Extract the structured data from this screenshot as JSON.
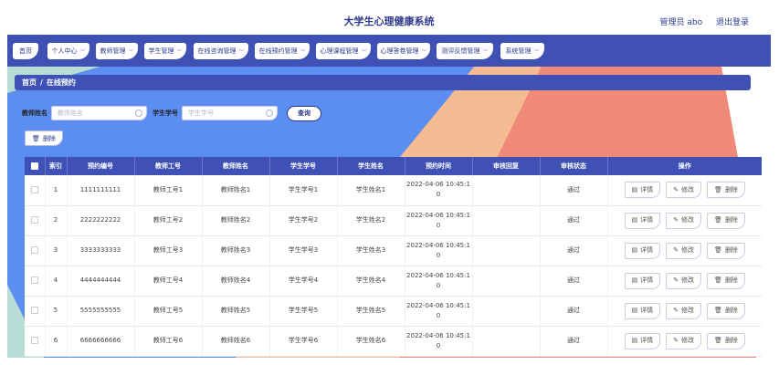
{
  "header": {
    "title": "大学生心理健康系统",
    "admin_label": "管理员 abo",
    "logout_label": "退出登录"
  },
  "nav": {
    "items": [
      {
        "label": "首页",
        "dropdown": false
      },
      {
        "label": "个人中心",
        "dropdown": true
      },
      {
        "label": "教师管理",
        "dropdown": true
      },
      {
        "label": "学生管理",
        "dropdown": true
      },
      {
        "label": "在线咨询管理",
        "dropdown": true
      },
      {
        "label": "在线预约管理",
        "dropdown": true
      },
      {
        "label": "心理课程管理",
        "dropdown": true
      },
      {
        "label": "心理答卷管理",
        "dropdown": true
      },
      {
        "label": "测评反馈管理",
        "dropdown": true
      },
      {
        "label": "系统管理",
        "dropdown": true
      }
    ]
  },
  "breadcrumb": {
    "home": "首页",
    "separator": "/",
    "current": "在线预约"
  },
  "search": {
    "teacher_label": "教师姓名",
    "teacher_placeholder": "教师姓名",
    "student_label": "学生学号",
    "student_placeholder": "学生学号",
    "query_label": "查询"
  },
  "toolbar": {
    "delete_label": "删除"
  },
  "table": {
    "columns": [
      "",
      "索引",
      "预约编号",
      "教师工号",
      "教师姓名",
      "学生学号",
      "学生姓名",
      "预约时间",
      "审核回复",
      "审核状态",
      "操作"
    ],
    "actions": {
      "detail": "详情",
      "edit": "修改",
      "delete": "删除"
    },
    "rows": [
      {
        "index": "1",
        "code": "1111111111",
        "teacher_id": "教师工号1",
        "teacher_name": "教师姓名1",
        "student_id": "学生学号1",
        "student_name": "学生姓名1",
        "time_line1": "2022-04-06 10:45:1",
        "time_line2": "0",
        "reply": "",
        "status": "通过"
      },
      {
        "index": "2",
        "code": "2222222222",
        "teacher_id": "教师工号2",
        "teacher_name": "教师姓名2",
        "student_id": "学生学号2",
        "student_name": "学生姓名2",
        "time_line1": "2022-04-06 10:45:1",
        "time_line2": "0",
        "reply": "",
        "status": "通过"
      },
      {
        "index": "3",
        "code": "3333333333",
        "teacher_id": "教师工号3",
        "teacher_name": "教师姓名3",
        "student_id": "学生学号3",
        "student_name": "学生姓名3",
        "time_line1": "2022-04-06 10:45:1",
        "time_line2": "0",
        "reply": "",
        "status": "通过"
      },
      {
        "index": "4",
        "code": "4444444444",
        "teacher_id": "教师工号4",
        "teacher_name": "教师姓名4",
        "student_id": "学生学号4",
        "student_name": "学生姓名4",
        "time_line1": "2022-04-06 10:45:1",
        "time_line2": "0",
        "reply": "",
        "status": "通过"
      },
      {
        "index": "5",
        "code": "5555555555",
        "teacher_id": "教师工号5",
        "teacher_name": "教师姓名5",
        "student_id": "学生学号5",
        "student_name": "学生姓名5",
        "time_line1": "2022-04-06 10:45:1",
        "time_line2": "0",
        "reply": "",
        "status": "通过"
      },
      {
        "index": "6",
        "code": "6666666666",
        "teacher_id": "教师工号6",
        "teacher_name": "教师姓名6",
        "student_id": "学生学号6",
        "student_name": "学生姓名6",
        "time_line1": "2022-04-06 10:45:1",
        "time_line2": "0",
        "reply": "",
        "status": "通过"
      }
    ]
  },
  "colors": {
    "primary": "#3f51b5",
    "bg_blue": "#5b8ef0",
    "bg_peach": "#f5b98f",
    "bg_salmon": "#f2897a",
    "bg_teal": "#b7ddd5"
  }
}
